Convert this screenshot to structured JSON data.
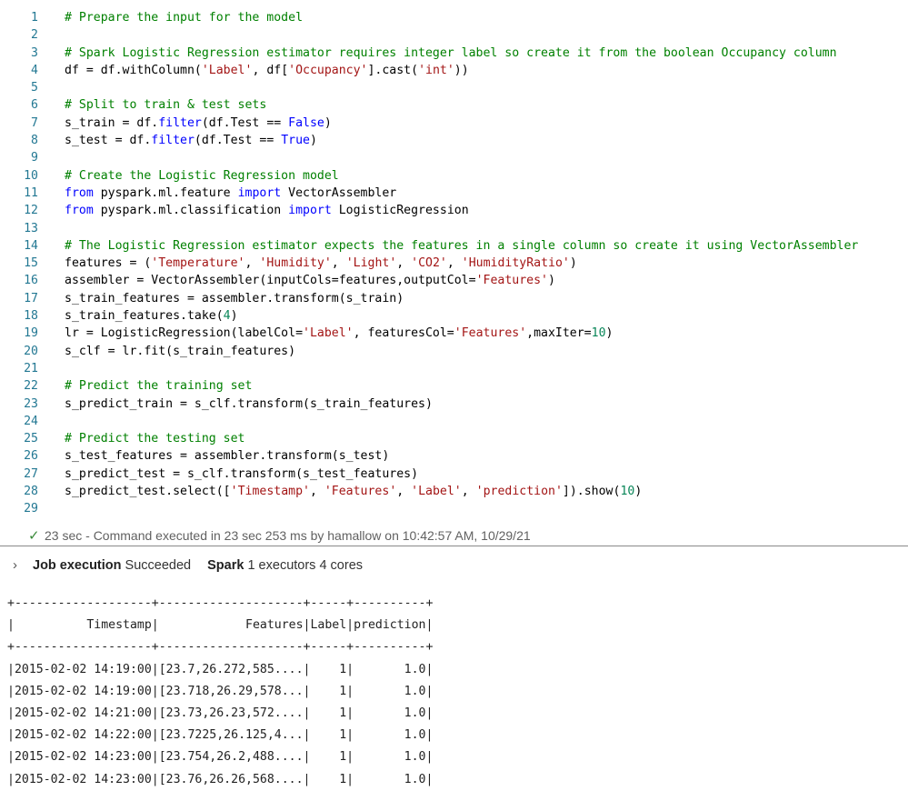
{
  "code": {
    "lines": [
      {
        "num": "1",
        "tokens": [
          {
            "t": "# Prepare the input for the model",
            "c": "c"
          }
        ]
      },
      {
        "num": "2",
        "tokens": []
      },
      {
        "num": "3",
        "tokens": [
          {
            "t": "# Spark Logistic Regression estimator requires integer label so create it from the boolean Occupancy column",
            "c": "c"
          }
        ]
      },
      {
        "num": "4",
        "tokens": [
          {
            "t": "df = df.withColumn(",
            "c": ""
          },
          {
            "t": "'Label'",
            "c": "s"
          },
          {
            "t": ", df[",
            "c": ""
          },
          {
            "t": "'Occupancy'",
            "c": "s"
          },
          {
            "t": "].cast(",
            "c": ""
          },
          {
            "t": "'int'",
            "c": "s"
          },
          {
            "t": "))",
            "c": ""
          }
        ]
      },
      {
        "num": "5",
        "tokens": []
      },
      {
        "num": "6",
        "tokens": [
          {
            "t": "# Split to train & test sets",
            "c": "c"
          }
        ]
      },
      {
        "num": "7",
        "tokens": [
          {
            "t": "s_train = df.",
            "c": ""
          },
          {
            "t": "filter",
            "c": "k"
          },
          {
            "t": "(df.Test == ",
            "c": ""
          },
          {
            "t": "False",
            "c": "k"
          },
          {
            "t": ")",
            "c": ""
          }
        ]
      },
      {
        "num": "8",
        "tokens": [
          {
            "t": "s_test = df.",
            "c": ""
          },
          {
            "t": "filter",
            "c": "k"
          },
          {
            "t": "(df.Test == ",
            "c": ""
          },
          {
            "t": "True",
            "c": "k"
          },
          {
            "t": ")",
            "c": ""
          }
        ]
      },
      {
        "num": "9",
        "tokens": []
      },
      {
        "num": "10",
        "tokens": [
          {
            "t": "# Create the Logistic Regression model",
            "c": "c"
          }
        ]
      },
      {
        "num": "11",
        "tokens": [
          {
            "t": "from",
            "c": "k"
          },
          {
            "t": " pyspark.ml.feature ",
            "c": ""
          },
          {
            "t": "import",
            "c": "k"
          },
          {
            "t": " VectorAssembler",
            "c": ""
          }
        ]
      },
      {
        "num": "12",
        "tokens": [
          {
            "t": "from",
            "c": "k"
          },
          {
            "t": " pyspark.ml.classification ",
            "c": ""
          },
          {
            "t": "import",
            "c": "k"
          },
          {
            "t": " LogisticRegression",
            "c": ""
          }
        ]
      },
      {
        "num": "13",
        "tokens": []
      },
      {
        "num": "14",
        "tokens": [
          {
            "t": "# The Logistic Regression estimator expects the features in a single column so create it using VectorAssembler",
            "c": "c"
          }
        ]
      },
      {
        "num": "15",
        "tokens": [
          {
            "t": "features = (",
            "c": ""
          },
          {
            "t": "'Temperature'",
            "c": "s"
          },
          {
            "t": ", ",
            "c": ""
          },
          {
            "t": "'Humidity'",
            "c": "s"
          },
          {
            "t": ", ",
            "c": ""
          },
          {
            "t": "'Light'",
            "c": "s"
          },
          {
            "t": ", ",
            "c": ""
          },
          {
            "t": "'CO2'",
            "c": "s"
          },
          {
            "t": ", ",
            "c": ""
          },
          {
            "t": "'HumidityRatio'",
            "c": "s"
          },
          {
            "t": ")",
            "c": ""
          }
        ]
      },
      {
        "num": "16",
        "tokens": [
          {
            "t": "assembler = VectorAssembler(inputCols=features,outputCol=",
            "c": ""
          },
          {
            "t": "'Features'",
            "c": "s"
          },
          {
            "t": ")",
            "c": ""
          }
        ]
      },
      {
        "num": "17",
        "tokens": [
          {
            "t": "s_train_features = assembler.transform(s_train)",
            "c": ""
          }
        ]
      },
      {
        "num": "18",
        "tokens": [
          {
            "t": "s_train_features.take(",
            "c": ""
          },
          {
            "t": "4",
            "c": "n"
          },
          {
            "t": ")",
            "c": ""
          }
        ]
      },
      {
        "num": "19",
        "tokens": [
          {
            "t": "lr = LogisticRegression(labelCol=",
            "c": ""
          },
          {
            "t": "'Label'",
            "c": "s"
          },
          {
            "t": ", featuresCol=",
            "c": ""
          },
          {
            "t": "'Features'",
            "c": "s"
          },
          {
            "t": ",maxIter=",
            "c": ""
          },
          {
            "t": "10",
            "c": "n"
          },
          {
            "t": ")",
            "c": ""
          }
        ]
      },
      {
        "num": "20",
        "tokens": [
          {
            "t": "s_clf = lr.fit(s_train_features)",
            "c": ""
          }
        ]
      },
      {
        "num": "21",
        "tokens": []
      },
      {
        "num": "22",
        "tokens": [
          {
            "t": "# Predict the training set",
            "c": "c"
          }
        ]
      },
      {
        "num": "23",
        "tokens": [
          {
            "t": "s_predict_train = s_clf.transform(s_train_features)",
            "c": ""
          }
        ]
      },
      {
        "num": "24",
        "tokens": []
      },
      {
        "num": "25",
        "tokens": [
          {
            "t": "# Predict the testing set",
            "c": "c"
          }
        ]
      },
      {
        "num": "26",
        "tokens": [
          {
            "t": "s_test_features = assembler.transform(s_test)",
            "c": ""
          }
        ]
      },
      {
        "num": "27",
        "tokens": [
          {
            "t": "s_predict_test = s_clf.transform(s_test_features)",
            "c": ""
          }
        ]
      },
      {
        "num": "28",
        "tokens": [
          {
            "t": "s_predict_test.select([",
            "c": ""
          },
          {
            "t": "'Timestamp'",
            "c": "s"
          },
          {
            "t": ", ",
            "c": ""
          },
          {
            "t": "'Features'",
            "c": "s"
          },
          {
            "t": ", ",
            "c": ""
          },
          {
            "t": "'Label'",
            "c": "s"
          },
          {
            "t": ", ",
            "c": ""
          },
          {
            "t": "'prediction'",
            "c": "s"
          },
          {
            "t": "]).show(",
            "c": ""
          },
          {
            "t": "10",
            "c": "n"
          },
          {
            "t": ")",
            "c": ""
          }
        ]
      },
      {
        "num": "29",
        "tokens": []
      }
    ]
  },
  "status": {
    "icon": "checkmark-icon",
    "duration": "23 sec",
    "message": " - Command executed in 23 sec 253 ms by hamallow on 10:42:57 AM, 10/29/21"
  },
  "job": {
    "icon": "chevron-right-icon",
    "label": "Job execution",
    "state": "Succeeded",
    "engine_label": "Spark",
    "engine_info": "1 executors 4 cores"
  },
  "output": {
    "lines": [
      "+-------------------+--------------------+-----+----------+",
      "|          Timestamp|            Features|Label|prediction|",
      "+-------------------+--------------------+-----+----------+",
      "|2015-02-02 14:19:00|[23.7,26.272,585....|    1|       1.0|",
      "|2015-02-02 14:19:00|[23.718,26.29,578...|    1|       1.0|",
      "|2015-02-02 14:21:00|[23.73,26.23,572....|    1|       1.0|",
      "|2015-02-02 14:22:00|[23.7225,26.125,4...|    1|       1.0|",
      "|2015-02-02 14:23:00|[23.754,26.2,488....|    1|       1.0|",
      "|2015-02-02 14:23:00|[23.76,26.26,568....|    1|       1.0|"
    ]
  }
}
